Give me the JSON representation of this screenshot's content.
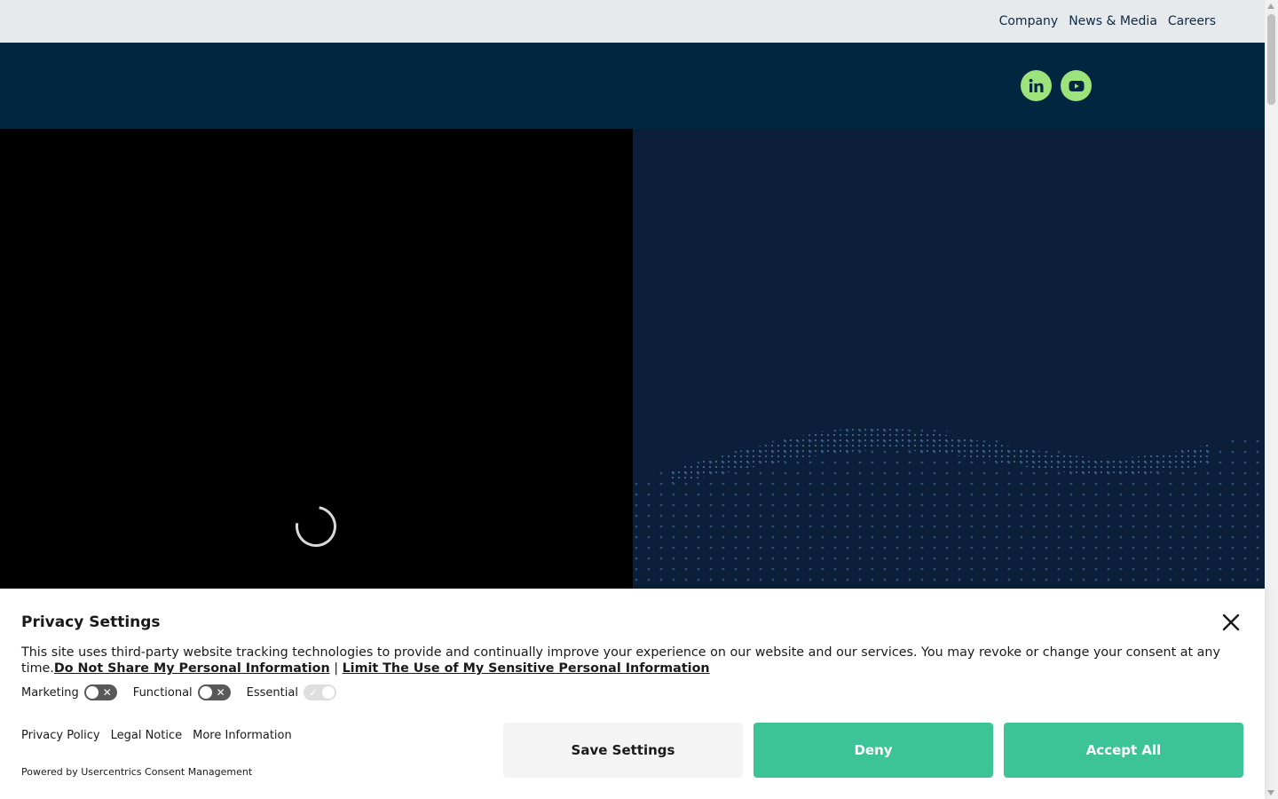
{
  "topnav": {
    "items": [
      {
        "label": "Company"
      },
      {
        "label": "News & Media"
      },
      {
        "label": "Careers"
      }
    ]
  },
  "header": {
    "social": [
      {
        "icon": "linkedin-icon"
      },
      {
        "icon": "youtube-icon"
      }
    ]
  },
  "video": {
    "state": "loading"
  },
  "privacy": {
    "title": "Privacy Settings",
    "description": "This site uses third-party website tracking technologies to provide and continually improve your experience on our website and our services. You may revoke or change your consent at any time.",
    "link_do_not_share": "Do Not Share My Personal Information",
    "separator": "|",
    "link_limit_use": "Limit The Use of My Sensitive Personal Information",
    "toggles": [
      {
        "label": "Marketing",
        "enabled": false,
        "disabled": false
      },
      {
        "label": "Functional",
        "enabled": false,
        "disabled": false
      },
      {
        "label": "Essential",
        "enabled": true,
        "disabled": true
      }
    ],
    "footer_links": [
      {
        "label": "Privacy Policy"
      },
      {
        "label": "Legal Notice"
      },
      {
        "label": "More Information"
      }
    ],
    "powered_by": "Powered by Usercentrics Consent Management",
    "buttons": {
      "save": "Save Settings",
      "deny": "Deny",
      "accept": "Accept All"
    }
  },
  "colors": {
    "topbar": "#e7eaed",
    "header": "#022640",
    "social_accent": "#9be37a",
    "hero": "#0b1f3a",
    "primary_button": "#3cc497"
  }
}
